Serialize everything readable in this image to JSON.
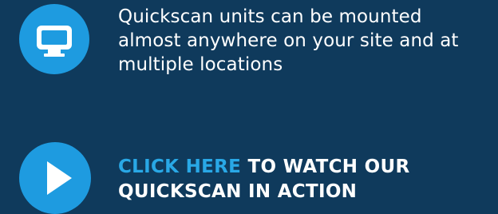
{
  "feature": {
    "icon": "monitor-icon",
    "lines": [
      "Quickscan units can be mounted",
      "almost anywhere on your site and at",
      "multiple locations"
    ]
  },
  "cta": {
    "icon": "play-icon",
    "link_text": "CLICK HERE",
    "line1_rest": " TO WATCH OUR",
    "line2": "QUICKSCAN IN ACTION"
  },
  "colors": {
    "background": "#0f3a5c",
    "accent": "#1e9be0",
    "link": "#29a8e6",
    "text": "#ffffff"
  }
}
